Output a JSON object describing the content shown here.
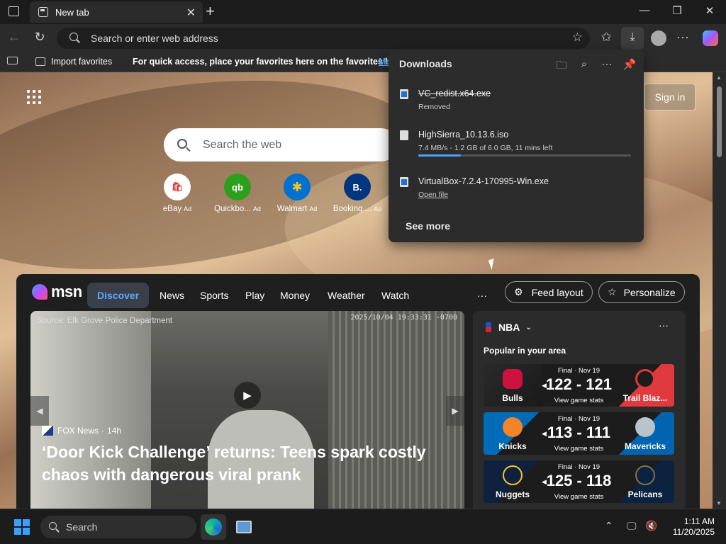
{
  "browser": {
    "tab": {
      "label": "New tab",
      "close": "✕"
    },
    "window_controls": {
      "minimize": "—",
      "maximize": "❐",
      "close": "✕"
    },
    "address_bar": {
      "placeholder": "Search or enter web address"
    },
    "favorites_bar": {
      "import_label": "Import favorites",
      "hint": "For quick access, place your favorites here on the favorites bar.",
      "hint_link": "Ma"
    }
  },
  "new_tab": {
    "sign_in_label": "Sign in",
    "search_placeholder": "Search the web",
    "quick_links": [
      {
        "label": "eBay",
        "ad": "Ad",
        "icon": "ebay-icon",
        "color": "#ffffff"
      },
      {
        "label": "Quickbo...",
        "ad": "Ad",
        "icon": "quickbooks-icon",
        "color": "#2ca01c"
      },
      {
        "label": "Walmart",
        "ad": "Ad",
        "icon": "walmart-icon",
        "color": "#0071ce"
      },
      {
        "label": "Bookinq....",
        "ad": "Ad",
        "icon": "booking-icon",
        "color": "#003580"
      }
    ]
  },
  "downloads": {
    "title": "Downloads",
    "items": [
      {
        "name": "VC_redist.x64.exe",
        "status": "Removed",
        "removed": true
      },
      {
        "name": "HighSierra_10.13.6.iso",
        "status": "7.4 MB/s - 1.2 GB of 6.0 GB, 11 mins left",
        "progress": 0.2
      },
      {
        "name": "VirtualBox-7.2.4-170995-Win.exe",
        "status": "Open file"
      }
    ],
    "see_more": "See more"
  },
  "msn": {
    "logo_text": "msn",
    "tabs": [
      "Discover",
      "News",
      "Sports",
      "Play",
      "Money",
      "Weather",
      "Watch"
    ],
    "more": "···",
    "feed_layout_label": "Feed layout",
    "personalize_label": "Personalize",
    "hero": {
      "source": "Source: Elk Grove Police Department",
      "timestamp": "2025/10/04 19:33:31 -0700",
      "publisher": "FOX News",
      "age": "14h",
      "headline": "‘Door Kick Challenge’ returns: Teens spark costly chaos with dangerous viral prank"
    },
    "nba": {
      "title": "NBA",
      "subtitle": "Popular in your area",
      "games": [
        {
          "status": "Final · Nov 19",
          "left": "Bulls",
          "right": "Trail Blaz...",
          "score": "122 - 121",
          "stats": "View game stats",
          "left_color": "#1a1a1a",
          "right_color": "#e03a3e"
        },
        {
          "status": "Final · Nov 19",
          "left": "Knicks",
          "right": "Mavericks",
          "score": "113 - 111",
          "stats": "View game stats",
          "left_color": "#006bb6",
          "right_color": "#0064b1"
        },
        {
          "status": "Final · Nov 19",
          "left": "Nuggets",
          "right": "Pelicans",
          "score": "125 - 118",
          "stats": "View game stats",
          "left_color": "#0e2240",
          "right_color": "#0c2340"
        }
      ]
    }
  },
  "taskbar": {
    "search_placeholder": "Search",
    "time": "1:11 AM",
    "date": "11/20/2025"
  }
}
